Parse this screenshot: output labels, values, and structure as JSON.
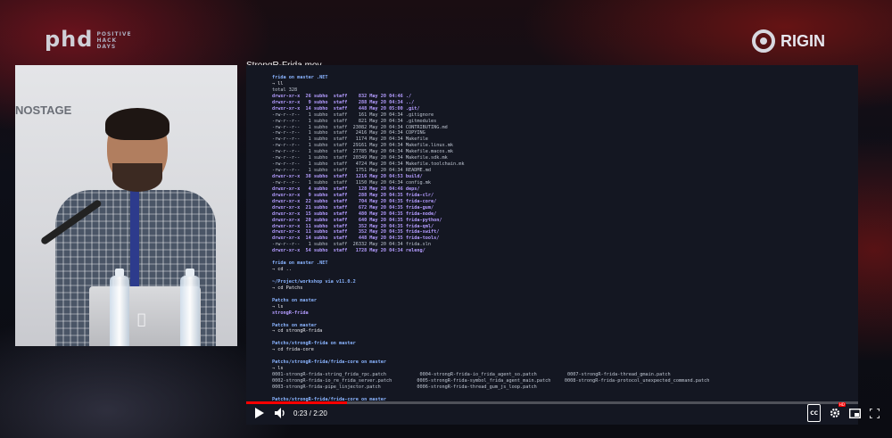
{
  "branding": {
    "left_logo": "phd",
    "left_logo_small": [
      "POSITIVE",
      "HACK",
      "DAYS"
    ],
    "right_logo": "RIGIN"
  },
  "webcam": {
    "stage_text": "NOSTAGE"
  },
  "video": {
    "title": "StrongR-Frida.mov",
    "current_time": "0:23",
    "duration": "2:20",
    "time_display": "0:23 / 2:20",
    "progress": 0.164,
    "controls": {
      "play": "play-icon",
      "volume": "volume-icon",
      "captions": "CC",
      "settings": "gear-icon",
      "settings_badge": "HD",
      "miniplayer": "miniplayer-icon",
      "fullscreen": "fullscreen-icon"
    }
  },
  "terminal": {
    "lines": [
      [
        "frida on master .NET",
        "prompt"
      ],
      [
        "→ ll",
        "cmd"
      ],
      [
        "total 328",
        ""
      ],
      [
        "drwxr-xr-x  26 subho  staff    832 May 20 04:46 ./",
        "dir"
      ],
      [
        "drwxr-xr-x   9 subho  staff    288 May 20 04:34 ../",
        "dir"
      ],
      [
        "drwxr-xr-x  14 subho  staff    448 May 20 05:00 .git/",
        "dir"
      ],
      [
        "-rw-r--r--   1 subho  staff    161 May 20 04:34 .gitignore",
        ""
      ],
      [
        "-rw-r--r--   1 subho  staff    821 May 20 04:34 .gitmodules",
        ""
      ],
      [
        "-rw-r--r--   1 subho  staff  23082 May 20 04:34 CONTRIBUTING.md",
        ""
      ],
      [
        "-rw-r--r--   1 subho  staff   2416 May 20 04:34 COPYING",
        ""
      ],
      [
        "-rw-r--r--   1 subho  staff   1174 May 20 04:34 Makefile",
        ""
      ],
      [
        "-rw-r--r--   1 subho  staff  29161 May 20 04:34 Makefile.linux.mk",
        ""
      ],
      [
        "-rw-r--r--   1 subho  staff  27785 May 20 04:34 Makefile.macos.mk",
        ""
      ],
      [
        "-rw-r--r--   1 subho  staff  20349 May 20 04:34 Makefile.sdk.mk",
        ""
      ],
      [
        "-rw-r--r--   1 subho  staff   4724 May 20 04:34 Makefile.toolchain.mk",
        ""
      ],
      [
        "-rw-r--r--   1 subho  staff   1751 May 20 04:34 README.md",
        ""
      ],
      [
        "drwxr-xr-x  38 subho  staff   1216 May 20 04:53 build/",
        "dir"
      ],
      [
        "-rw-r--r--   1 subho  staff   1150 May 20 04:34 config.mk",
        ""
      ],
      [
        "drwxr-xr-x   4 subho  staff    128 May 20 04:46 deps/",
        "dir"
      ],
      [
        "drwxr-xr-x   9 subho  staff    288 May 20 04:35 frida-clr/",
        "dir"
      ],
      [
        "drwxr-xr-x  22 subho  staff    704 May 20 04:35 frida-core/",
        "dir"
      ],
      [
        "drwxr-xr-x  21 subho  staff    672 May 20 04:35 frida-gum/",
        "dir"
      ],
      [
        "drwxr-xr-x  15 subho  staff    480 May 20 04:35 frida-node/",
        "dir"
      ],
      [
        "drwxr-xr-x  20 subho  staff    640 May 20 04:35 frida-python/",
        "dir"
      ],
      [
        "drwxr-xr-x  11 subho  staff    352 May 20 04:35 frida-qml/",
        "dir"
      ],
      [
        "drwxr-xr-x  11 subho  staff    352 May 20 04:35 frida-swift/",
        "dir"
      ],
      [
        "drwxr-xr-x  14 subho  staff    448 May 20 04:35 frida-tools/",
        "dir"
      ],
      [
        "-rw-r--r--   1 subho  staff  26332 May 20 04:34 frida.sln",
        ""
      ],
      [
        "drwxr-xr-x  54 subho  staff   1728 May 20 04:34 releng/",
        "dir"
      ],
      [
        "",
        ""
      ],
      [
        "frida on master .NET",
        "prompt"
      ],
      [
        "→ cd ..",
        "cmd"
      ],
      [
        "",
        ""
      ],
      [
        "~/Project/workshop via v11.0.2",
        "prompt"
      ],
      [
        "→ cd Patchs",
        "cmd"
      ],
      [
        "",
        ""
      ],
      [
        "Patchs on master",
        "prompt"
      ],
      [
        "→ ls",
        "cmd"
      ],
      [
        "strongR-frida",
        "dir"
      ],
      [
        "",
        ""
      ],
      [
        "Patchs on master",
        "prompt"
      ],
      [
        "→ cd strongR-frida",
        "cmd"
      ],
      [
        "",
        ""
      ],
      [
        "Patchs/strongR-frida on master",
        "prompt"
      ],
      [
        "→ cd frida-core",
        "cmd"
      ],
      [
        "",
        ""
      ],
      [
        "Patchs/strongR-frida/frida-core on master",
        "prompt"
      ],
      [
        "→ ls",
        "cmd"
      ],
      [
        "0001-strongR-frida-string_frida_rpc.patch            0004-strongR-frida-io_frida_agent_so.patch           0007-strongR-frida-thread_gmain.patch",
        ""
      ],
      [
        "0002-strongR-frida-io_re_frida_server.patch         0005-strongR-frida-symbol_frida_agent_main.patch     0008-strongR-frida-protocol_unexpected_command.patch",
        ""
      ],
      [
        "0003-strongR-frida-pipe_linjector.patch             0006-strongR-frida-thread_gum_js_loop.patch",
        ""
      ],
      [
        "",
        ""
      ],
      [
        "Patchs/strongR-frida/frida-core on master",
        "prompt"
      ]
    ]
  }
}
